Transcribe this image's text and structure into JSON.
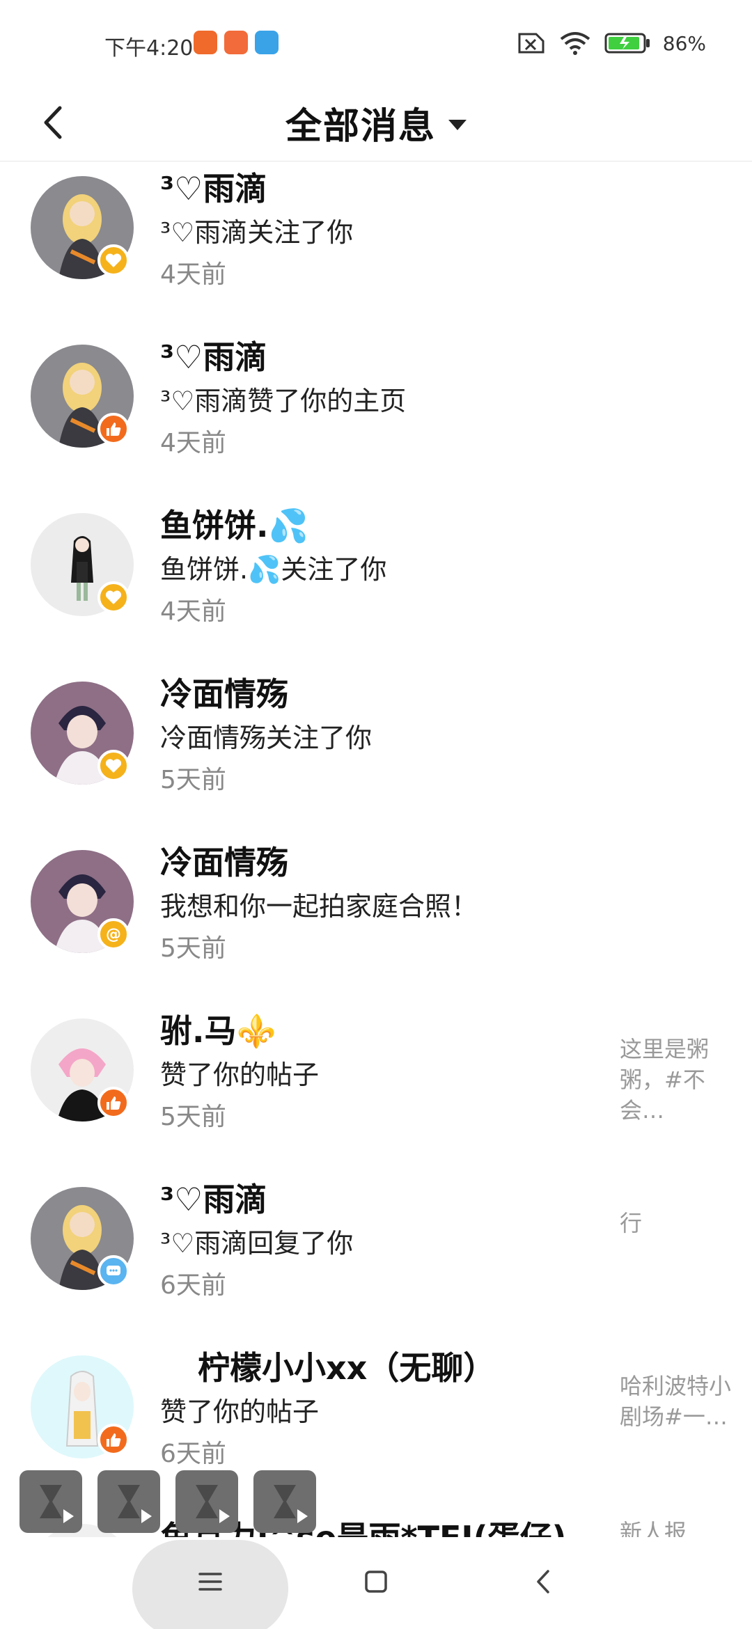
{
  "status_bar": {
    "time": "下午4:20",
    "battery": "86%",
    "app_icon_colors": [
      "#f06a2b",
      "#f26b3a",
      "#3aa3e8"
    ]
  },
  "header": {
    "title": "全部消息"
  },
  "messages": [
    {
      "name": "³♡雨滴",
      "desc": "³♡雨滴关注了你",
      "time": "4天前",
      "badge": "heart",
      "badge_color": "#f5b21b",
      "avatar": "blonde",
      "side": ""
    },
    {
      "name": "³♡雨滴",
      "desc": "³♡雨滴赞了你的主页",
      "time": "4天前",
      "badge": "thumb",
      "badge_color": "#f26b1d",
      "avatar": "blonde",
      "side": ""
    },
    {
      "name": "鱼饼饼.💦",
      "desc": "鱼饼饼.💦关注了你",
      "time": "4天前",
      "badge": "heart",
      "badge_color": "#f5b21b",
      "avatar": "dark-hair",
      "side": ""
    },
    {
      "name": "冷面情殇",
      "desc": "冷面情殇关注了你",
      "time": "5天前",
      "badge": "heart",
      "badge_color": "#f5b21b",
      "avatar": "boy",
      "side": ""
    },
    {
      "name": "冷面情殇",
      "desc": "我想和你一起拍家庭合照！",
      "time": "5天前",
      "badge": "at",
      "badge_color": "#f5b21b",
      "avatar": "boy",
      "side": ""
    },
    {
      "name": "驸.马⚜️",
      "desc": "赞了你的帖子",
      "time": "5天前",
      "badge": "thumb",
      "badge_color": "#f26b1d",
      "avatar": "pink-hair",
      "side": "这里是粥粥，#不会…"
    },
    {
      "name": "³♡雨滴",
      "desc": "³♡雨滴回复了你",
      "time": "6天前",
      "badge": "chat",
      "badge_color": "#5ab4f0",
      "avatar": "blonde",
      "side": "行"
    },
    {
      "name": "柠檬小小xx（无聊）",
      "desc": "赞了你的帖子",
      "time": "6天前",
      "badge": "thumb",
      "badge_color": "#f26b1d",
      "avatar": "white-hair",
      "side": "哈利波特小剧场#一…"
    },
    {
      "name": "鱼月力:^se是雨*TFI(蛋仔)",
      "desc": "",
      "time": "",
      "badge": "",
      "badge_color": "",
      "avatar": "partial",
      "side": "新人报"
    }
  ]
}
